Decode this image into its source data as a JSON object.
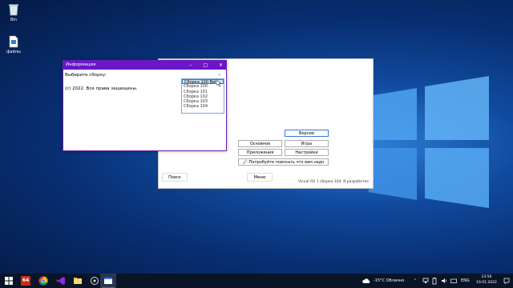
{
  "desktop": {
    "icons": [
      {
        "label": "Bin"
      },
      {
        "label": "файлы"
      }
    ]
  },
  "main_window": {
    "buttons": {
      "versions": "Версии",
      "basic": "Основное",
      "games": "Игры",
      "apps": "Приложения",
      "settings": "Настройки",
      "try_find": "Попробуйте поискать что вам надо",
      "search": "Поиск",
      "menu": "Меню"
    },
    "version_text": "Visual OS 1 сборка 104. В разработке"
  },
  "info_window": {
    "title": "Информация",
    "select_prompt": "Выберите сборку:",
    "copyright": "(c) 2022. Все права защищены.",
    "dropdown_options": [
      "Сборка 100 Beta",
      "Сборка 100",
      "Сборка 101",
      "Сборка 102",
      "Сборка 103",
      "Сборка 104"
    ],
    "selected_index": 0
  },
  "taskbar": {
    "pinned_icon_names": [
      "start-icon",
      "app-64-icon",
      "chrome-icon",
      "visual-studio-icon",
      "file-explorer-icon",
      "settings-app-icon",
      "active-app-icon"
    ],
    "badge_text": "64",
    "weather": "-15°C  Облачно",
    "language": "ENG",
    "time": "23:56",
    "date": "19.01.2022",
    "accent": "#0078d7"
  }
}
